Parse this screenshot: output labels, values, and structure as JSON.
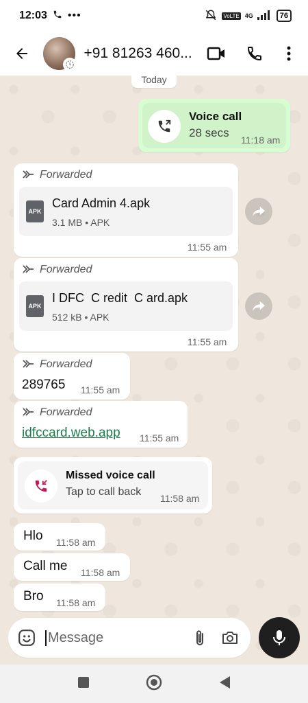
{
  "status_bar": {
    "time": "12:03",
    "battery": "76",
    "network": "4G"
  },
  "header": {
    "contact": "+91 81263 460..."
  },
  "chat": {
    "date_chip": "Today",
    "messages": [
      {
        "type": "call",
        "direction": "out",
        "title": "Voice call",
        "subtitle": "28 secs",
        "time": "11:18 am"
      },
      {
        "type": "document",
        "forwarded_label": "Forwarded",
        "filename": "Card Admin 4.apk",
        "size": "3.1 MB",
        "ext": "APK",
        "meta": "3.1 MB • APK",
        "time": "11:55 am"
      },
      {
        "type": "document",
        "forwarded_label": "Forwarded",
        "filename": "I DFC  C redit  C ard.apk",
        "size": "512 kB",
        "ext": "APK",
        "meta": "512 kB • APK",
        "time": "11:55 am"
      },
      {
        "type": "text",
        "forwarded_label": "Forwarded",
        "text": "289765",
        "time": "11:55 am"
      },
      {
        "type": "link",
        "forwarded_label": "Forwarded",
        "text": "idfccard.web.app",
        "time": "11:55 am"
      },
      {
        "type": "missed_call",
        "title": "Missed voice call",
        "subtitle": "Tap to call back",
        "time": "11:58 am"
      },
      {
        "type": "text",
        "text": "Hlo",
        "time": "11:58 am"
      },
      {
        "type": "text",
        "text": "Call me",
        "time": "11:58 am"
      },
      {
        "type": "text",
        "text": "Bro",
        "time": "11:58 am"
      }
    ]
  },
  "composer": {
    "placeholder": "Message"
  },
  "colors": {
    "outgoing_bubble": "#d9fdd3",
    "incoming_bubble": "#ffffff",
    "link": "#1a7d4a",
    "missed_call": "#c2185b",
    "chat_bg": "#efe7de"
  },
  "icons": [
    "back-arrow-icon",
    "video-call-icon",
    "phone-icon",
    "more-vert-icon",
    "emoji-icon",
    "attach-icon",
    "camera-icon",
    "mic-icon",
    "forward-icon",
    "apk-file-icon",
    "share-icon",
    "outgoing-call-icon",
    "missed-call-icon"
  ]
}
